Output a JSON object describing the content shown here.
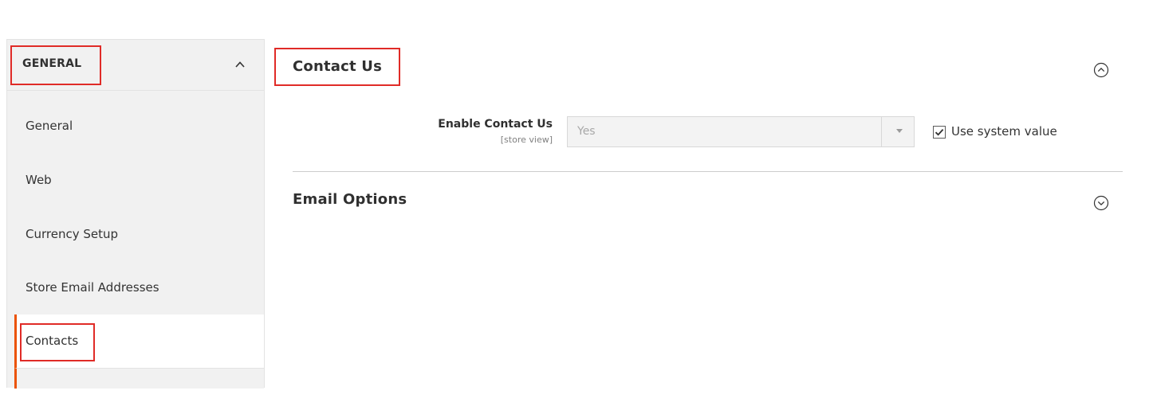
{
  "sidebar": {
    "header": {
      "title": "GENERAL",
      "icon": "chevron-up-icon"
    },
    "items": [
      {
        "label": "General"
      },
      {
        "label": "Web"
      },
      {
        "label": "Currency Setup"
      },
      {
        "label": "Store Email Addresses"
      },
      {
        "label": "Contacts",
        "active": true
      }
    ]
  },
  "main": {
    "contact_us": {
      "title": "Contact Us",
      "toggle_icon": "collapse-circle-icon",
      "field": {
        "label": "Enable Contact Us",
        "scope": "[store view]",
        "value": "Yes",
        "use_system_value_label": "Use system value",
        "use_system_value_checked": true
      }
    },
    "email_options": {
      "title": "Email Options",
      "toggle_icon": "expand-circle-icon"
    }
  },
  "colors": {
    "highlight": "#e02b27",
    "active_accent": "#eb5202",
    "sidebar_bg": "#f1f1f1"
  }
}
